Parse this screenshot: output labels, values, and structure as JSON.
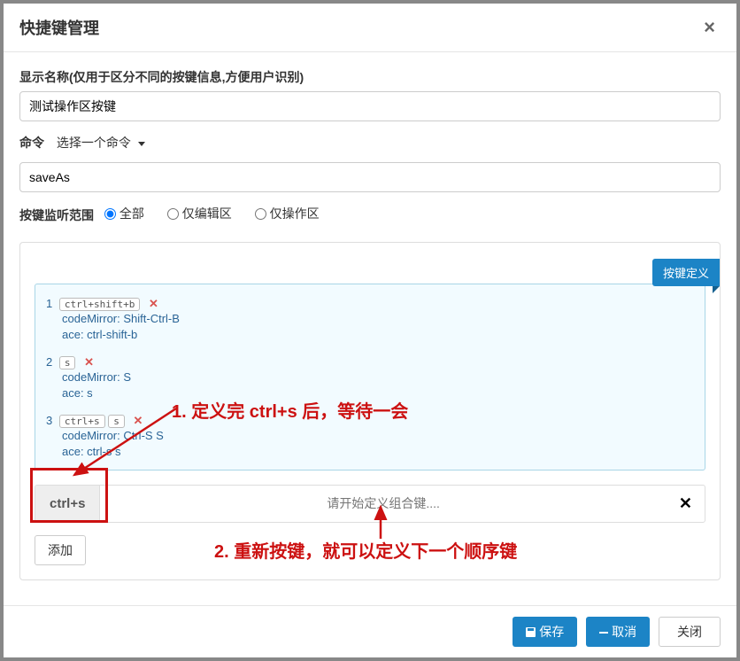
{
  "modal": {
    "title": "快捷键管理"
  },
  "form": {
    "display_name_label": "显示名称(仅用于区分不同的按键信息,方便用户识别)",
    "display_name_value": "测试操作区按键",
    "command_label": "命令",
    "command_select_text": "选择一个命令",
    "command_value": "saveAs",
    "scope_label": "按键监听范围",
    "scope_options": {
      "all": "全部",
      "editor": "仅编辑区",
      "action": "仅操作区"
    }
  },
  "defs": {
    "badge": "按键定义",
    "rows": [
      {
        "num": "1",
        "kbds": [
          "ctrl+shift+b"
        ],
        "cm": "codeMirror: Shift-Ctrl-B",
        "ace": "ace: ctrl-shift-b"
      },
      {
        "num": "2",
        "kbds": [
          "s"
        ],
        "cm": "codeMirror: S",
        "ace": "ace: s"
      },
      {
        "num": "3",
        "kbds": [
          "ctrl+s",
          "s"
        ],
        "cm": "codeMirror: Ctrl-S S",
        "ace": "ace: ctrl-s s"
      }
    ],
    "captured": "ctrl+s",
    "capture_placeholder": "请开始定义组合键....",
    "clear": "✕",
    "add_btn": "添加"
  },
  "footer": {
    "save": "保存",
    "cancel": "取消",
    "close": "关闭"
  },
  "annotations": {
    "a1": "1. 定义完 ctrl+s 后，等待一会",
    "a2": "2. 重新按键，就可以定义下一个顺序键"
  }
}
